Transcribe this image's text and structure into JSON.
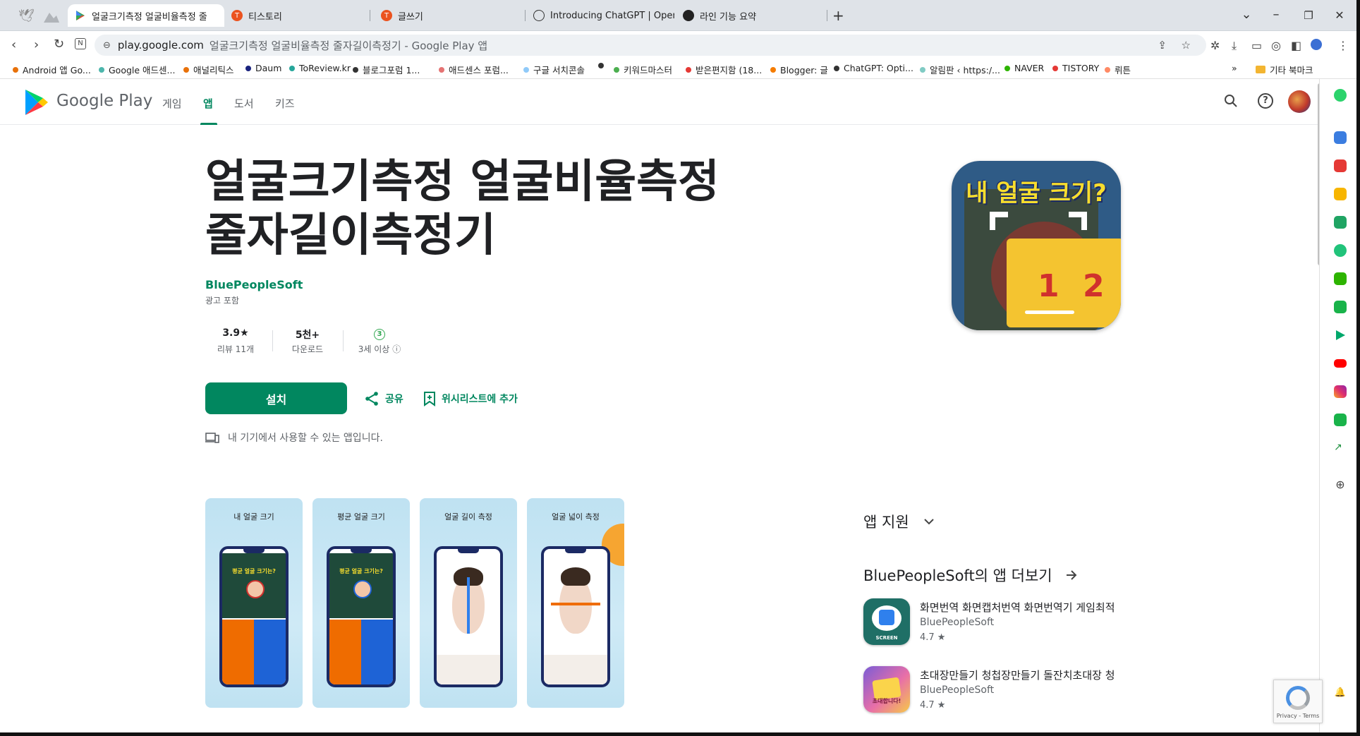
{
  "tabs": [
    {
      "title": "얼굴크기측정 얼굴비율측정 줄",
      "active": true
    },
    {
      "title": "티스토리",
      "active": false
    },
    {
      "title": "글쓰기",
      "active": false
    },
    {
      "title": "Introducing ChatGPT | OpenA",
      "active": false
    },
    {
      "title": "라인 기능 요약",
      "active": false
    }
  ],
  "new_tab": "+",
  "window": {
    "minimize": "–",
    "restore": "❐",
    "close": "✕",
    "tab_search": "⌄"
  },
  "address": {
    "host": "play.google.com",
    "title": "얼굴크기측정 얼굴비율측정 줄자길이측정기 - Google Play 앱"
  },
  "bookmarks": [
    {
      "label": "Android 앱 Go...",
      "color": "#e8710a"
    },
    {
      "label": "Google 애드센...",
      "color": "#4db6ac"
    },
    {
      "label": "애널리틱스",
      "color": "#e8710a"
    },
    {
      "label": "Daum",
      "color": "#1a237e"
    },
    {
      "label": "ToReview.kr",
      "color": "#26a69a"
    },
    {
      "label": "블로그포럼 1...",
      "color": "#333333"
    },
    {
      "label": "애드센스 포럼...",
      "color": "#e57373"
    },
    {
      "label": "구글 서치콘솔",
      "color": "#90caf9"
    },
    {
      "label": "키워드마스터",
      "color": "#4caf50"
    },
    {
      "label": "받은편지함 (18...",
      "color": "#e53935"
    },
    {
      "label": "Blogger: 글",
      "color": "#f57c00"
    },
    {
      "label": "ChatGPT: Opti...",
      "color": "#333333"
    },
    {
      "label": "알림판 ‹ https:/...",
      "color": "#80cbc4"
    },
    {
      "label": "NAVER",
      "color": "#2db400"
    },
    {
      "label": "TISTORY",
      "color": "#e53935"
    },
    {
      "label": "뤼튼",
      "color": "#ff8a65"
    }
  ],
  "bookmarks_more": "»",
  "other_bookmarks": "기타 북마크",
  "gp": {
    "logo_text": "Google Play",
    "nav": [
      "게임",
      "앱",
      "도서",
      "키즈"
    ],
    "active_nav": "앱"
  },
  "app": {
    "title_line1": "얼굴크기측정 얼굴비율측정",
    "title_line2": "줄자길이측정기",
    "developer": "BluePeopleSoft",
    "ads_label": "광고 포함",
    "rating_value": "3.9★",
    "rating_label": "리뷰 11개",
    "downloads_value": "5천+",
    "downloads_label": "다운로드",
    "age_value": "3",
    "age_label": "3세 이상",
    "install_label": "설치",
    "share_label": "공유",
    "wishlist_label": "위시리스트에 추가",
    "device_note": "내 기기에서 사용할 수 있는 앱입니다.",
    "icon_text": "내 얼굴 크기?",
    "icon_num1": "1",
    "icon_num2": "2"
  },
  "screenshots": [
    {
      "caption": "내 얼굴 크기",
      "inner_title": "평균 얼굴 크기는?"
    },
    {
      "caption": "평균 얼굴 크기",
      "inner_title": "평균 얼굴 크기는?"
    },
    {
      "caption": "얼굴 길이 측정"
    },
    {
      "caption": "얼굴 넓이 측정"
    }
  ],
  "support": {
    "label": "앱 지원"
  },
  "more_apps": {
    "heading": "BluePeopleSoft의 앱 더보기",
    "items": [
      {
        "title": "화면번역 화면캡처번역 화면번역기 게임최적",
        "developer": "BluePeopleSoft",
        "rating": "4.7 ★",
        "icon_label": "SCREEN"
      },
      {
        "title": "초대장만들기 청첩장만들기 돌잔치초대장 청",
        "developer": "BluePeopleSoft",
        "rating": "4.7 ★",
        "icon_label": "초대합니다!"
      }
    ]
  },
  "recaptcha": {
    "label": "Privacy - Terms"
  }
}
